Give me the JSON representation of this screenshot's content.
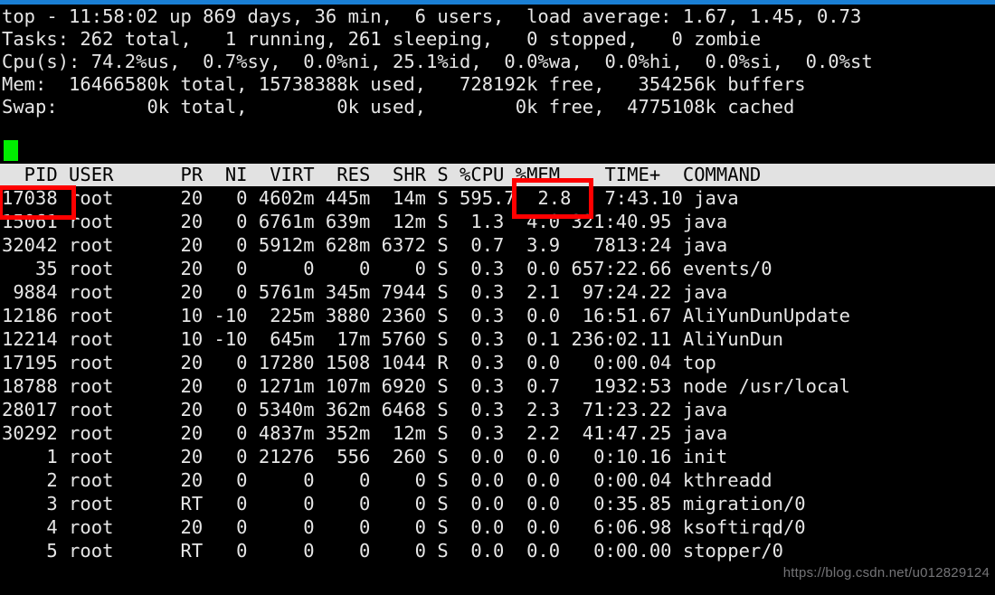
{
  "window": {
    "title": "top",
    "titlebar_color": "#1a7fd4",
    "background_color": "#000000",
    "text_color": "#e6e6e6"
  },
  "summary": {
    "lines": [
      "top - 11:58:02 up 869 days, 36 min,  6 users,  load average: 1.67, 1.45, 0.73",
      "Tasks: 262 total,   1 running, 261 sleeping,   0 stopped,   0 zombie",
      "Cpu(s): 74.2%us,  0.7%sy,  0.0%ni, 25.1%id,  0.0%wa,  0.0%hi,  0.0%si,  0.0%st",
      "Mem:  16466580k total, 15738388k used,   728192k free,   354256k buffers",
      "Swap:        0k total,        0k used,        0k free,  4775108k cached"
    ],
    "uptime": {
      "time": "11:58:02",
      "up_days": "869 days",
      "up_minutes": "36 min",
      "users": "6 users",
      "load_average": [
        "1.67",
        "1.45",
        "0.73"
      ]
    },
    "tasks": {
      "total": "262",
      "running": "1",
      "sleeping": "261",
      "stopped": "0",
      "zombie": "0"
    },
    "cpu": {
      "us": "74.2",
      "sy": "0.7",
      "ni": "0.0",
      "id": "25.1",
      "wa": "0.0",
      "hi": "0.0",
      "si": "0.0",
      "st": "0.0"
    },
    "mem": {
      "total": "16466580k",
      "used": "15738388k",
      "free": "728192k",
      "buffers": "354256k"
    },
    "swap": {
      "total": "0k",
      "used": "0k",
      "free": "0k",
      "cached": "4775108k"
    }
  },
  "cursor": {
    "color": "#00ee00"
  },
  "table": {
    "header_line": "  PID USER      PR  NI  VIRT  RES  SHR S %CPU %MEM    TIME+  COMMAND",
    "columns": [
      "PID",
      "USER",
      "PR",
      "NI",
      "VIRT",
      "RES",
      "SHR",
      "S",
      "%CPU",
      "%MEM",
      "TIME+",
      "COMMAND"
    ],
    "rows": [
      "17038 root      20   0 4602m 445m  14m S 595.7  2.8   7:43.10 java",
      "15061 root      20   0 6761m 639m  12m S  1.3  4.0 321:40.95 java",
      "32042 root      20   0 5912m 628m 6372 S  0.7  3.9   7813:24 java",
      "   35 root      20   0     0    0    0 S  0.3  0.0 657:22.66 events/0",
      " 9884 root      20   0 5761m 345m 7944 S  0.3  2.1  97:24.22 java",
      "12186 root      10 -10  225m 3880 2360 S  0.3  0.0  16:51.67 AliYunDunUpdate",
      "12214 root      10 -10  645m  17m 5760 S  0.3  0.1 236:02.11 AliYunDun",
      "17195 root      20   0 17280 1508 1044 R  0.3  0.0   0:00.04 top",
      "18788 root      20   0 1271m 107m 6920 S  0.3  0.7   1932:53 node /usr/local",
      "28017 root      20   0 5340m 362m 6468 S  0.3  2.3  71:23.22 java",
      "30292 root      20   0 4837m 352m  12m S  0.3  2.2  41:47.25 java",
      "    1 root      20   0 21276  556  260 S  0.0  0.0   0:10.16 init",
      "    2 root      20   0     0    0    0 S  0.0  0.0   0:00.04 kthreadd",
      "    3 root      RT   0     0    0    0 S  0.0  0.0   0:35.85 migration/0",
      "    4 root      20   0     0    0    0 S  0.0  0.0   6:06.98 ksoftirqd/0",
      "    5 root      RT   0     0    0    0 S  0.0  0.0   0:00.00 stopper/0"
    ],
    "rows_struct": [
      {
        "pid": "17038",
        "user": "root",
        "pr": "20",
        "ni": "0",
        "virt": "4602m",
        "res": "445m",
        "shr": "14m",
        "s": "S",
        "cpu": "595.7",
        "mem": "2.8",
        "time": "7:43.10",
        "command": "java"
      },
      {
        "pid": "15061",
        "user": "root",
        "pr": "20",
        "ni": "0",
        "virt": "6761m",
        "res": "639m",
        "shr": "12m",
        "s": "S",
        "cpu": "1.3",
        "mem": "4.0",
        "time": "321:40.95",
        "command": "java"
      },
      {
        "pid": "32042",
        "user": "root",
        "pr": "20",
        "ni": "0",
        "virt": "5912m",
        "res": "628m",
        "shr": "6372",
        "s": "S",
        "cpu": "0.7",
        "mem": "3.9",
        "time": "7813:24",
        "command": "java"
      },
      {
        "pid": "35",
        "user": "root",
        "pr": "20",
        "ni": "0",
        "virt": "0",
        "res": "0",
        "shr": "0",
        "s": "S",
        "cpu": "0.3",
        "mem": "0.0",
        "time": "657:22.66",
        "command": "events/0"
      },
      {
        "pid": "9884",
        "user": "root",
        "pr": "20",
        "ni": "0",
        "virt": "5761m",
        "res": "345m",
        "shr": "7944",
        "s": "S",
        "cpu": "0.3",
        "mem": "2.1",
        "time": "97:24.22",
        "command": "java"
      },
      {
        "pid": "12186",
        "user": "root",
        "pr": "10",
        "ni": "-10",
        "virt": "225m",
        "res": "3880",
        "shr": "2360",
        "s": "S",
        "cpu": "0.3",
        "mem": "0.0",
        "time": "16:51.67",
        "command": "AliYunDunUpdate"
      },
      {
        "pid": "12214",
        "user": "root",
        "pr": "10",
        "ni": "-10",
        "virt": "645m",
        "res": "17m",
        "shr": "5760",
        "s": "S",
        "cpu": "0.3",
        "mem": "0.1",
        "time": "236:02.11",
        "command": "AliYunDun"
      },
      {
        "pid": "17195",
        "user": "root",
        "pr": "20",
        "ni": "0",
        "virt": "17280",
        "res": "1508",
        "shr": "1044",
        "s": "R",
        "cpu": "0.3",
        "mem": "0.0",
        "time": "0:00.04",
        "command": "top"
      },
      {
        "pid": "18788",
        "user": "root",
        "pr": "20",
        "ni": "0",
        "virt": "1271m",
        "res": "107m",
        "shr": "6920",
        "s": "S",
        "cpu": "0.3",
        "mem": "0.7",
        "time": "1932:53",
        "command": "node /usr/local"
      },
      {
        "pid": "28017",
        "user": "root",
        "pr": "20",
        "ni": "0",
        "virt": "5340m",
        "res": "362m",
        "shr": "6468",
        "s": "S",
        "cpu": "0.3",
        "mem": "2.3",
        "time": "71:23.22",
        "command": "java"
      },
      {
        "pid": "30292",
        "user": "root",
        "pr": "20",
        "ni": "0",
        "virt": "4837m",
        "res": "352m",
        "shr": "12m",
        "s": "S",
        "cpu": "0.3",
        "mem": "2.2",
        "time": "41:47.25",
        "command": "java"
      },
      {
        "pid": "1",
        "user": "root",
        "pr": "20",
        "ni": "0",
        "virt": "21276",
        "res": "556",
        "shr": "260",
        "s": "S",
        "cpu": "0.0",
        "mem": "0.0",
        "time": "0:10.16",
        "command": "init"
      },
      {
        "pid": "2",
        "user": "root",
        "pr": "20",
        "ni": "0",
        "virt": "0",
        "res": "0",
        "shr": "0",
        "s": "S",
        "cpu": "0.0",
        "mem": "0.0",
        "time": "0:00.04",
        "command": "kthreadd"
      },
      {
        "pid": "3",
        "user": "root",
        "pr": "RT",
        "ni": "0",
        "virt": "0",
        "res": "0",
        "shr": "0",
        "s": "S",
        "cpu": "0.0",
        "mem": "0.0",
        "time": "0:35.85",
        "command": "migration/0"
      },
      {
        "pid": "4",
        "user": "root",
        "pr": "20",
        "ni": "0",
        "virt": "0",
        "res": "0",
        "shr": "0",
        "s": "S",
        "cpu": "0.0",
        "mem": "0.0",
        "time": "6:06.98",
        "command": "ksoftirqd/0"
      },
      {
        "pid": "5",
        "user": "root",
        "pr": "RT",
        "ni": "0",
        "virt": "0",
        "res": "0",
        "shr": "0",
        "s": "S",
        "cpu": "0.0",
        "mem": "0.0",
        "time": "0:00.00",
        "command": "stopper/0"
      }
    ]
  },
  "annotations": {
    "color": "#ff0000",
    "boxes": [
      {
        "name": "highlighted-pid",
        "value": "17038"
      },
      {
        "name": "highlighted-cpu",
        "value": "595.7"
      }
    ]
  },
  "watermark": {
    "text": "https://blog.csdn.net/u012829124"
  }
}
